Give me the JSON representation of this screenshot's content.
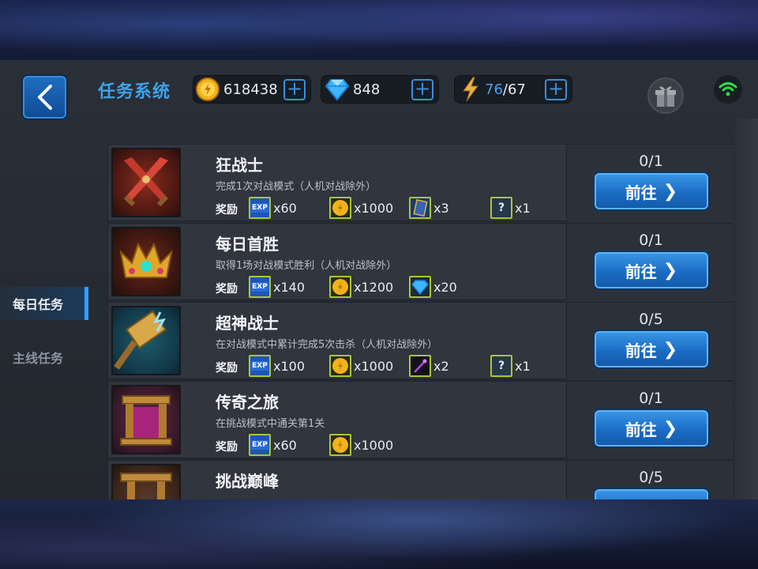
{
  "header": {
    "title": "任务系统",
    "back_icon": "chevron-left-icon",
    "gold": {
      "icon": "gold-coin-icon",
      "value": "618438"
    },
    "diamond": {
      "icon": "diamond-icon",
      "value": "848"
    },
    "energy": {
      "icon": "lightning-icon",
      "current": "76",
      "max": "/67"
    },
    "plus_label": "+",
    "gift_icon": "gift-icon",
    "wifi_icon": "wifi-icon"
  },
  "sidebar": {
    "tabs": [
      {
        "label": "每日任务",
        "active": true
      },
      {
        "label": "主线任务",
        "active": false
      }
    ]
  },
  "reward_label": "奖励",
  "goto_label": "前往",
  "quests": [
    {
      "name": "狂战士",
      "desc": "完成1次对战模式（人机对战除外）",
      "progress": "0/1",
      "icon": "crossed-swords-icon",
      "rewards": [
        {
          "icon": "exp-icon",
          "count": "x60"
        },
        {
          "icon": "gold-coin-icon",
          "count": "x1000"
        },
        {
          "icon": "card-icon",
          "count": "x3"
        },
        {
          "icon": "mystery-box-icon",
          "count": "x1"
        }
      ]
    },
    {
      "name": "每日首胜",
      "desc": "取得1场对战模式胜利（人机对战除外）",
      "progress": "0/1",
      "icon": "crown-icon",
      "rewards": [
        {
          "icon": "exp-icon",
          "count": "x140"
        },
        {
          "icon": "gold-coin-icon",
          "count": "x1200"
        },
        {
          "icon": "diamond-icon",
          "count": "x20"
        }
      ]
    },
    {
      "name": "超神战士",
      "desc": "在对战模式中累计完成5次击杀（人机对战除外）",
      "progress": "0/5",
      "icon": "thunder-hammer-icon",
      "rewards": [
        {
          "icon": "exp-icon",
          "count": "x100"
        },
        {
          "icon": "gold-coin-icon",
          "count": "x1000"
        },
        {
          "icon": "staff-icon",
          "count": "x2"
        },
        {
          "icon": "mystery-box-icon",
          "count": "x1"
        }
      ]
    },
    {
      "name": "传奇之旅",
      "desc": "在挑战模式中通关第1关",
      "progress": "0/1",
      "icon": "portal-gate-icon",
      "rewards": [
        {
          "icon": "exp-icon",
          "count": "x60"
        },
        {
          "icon": "gold-coin-icon",
          "count": "x1000"
        }
      ]
    },
    {
      "name": "挑战巅峰",
      "desc": "",
      "progress": "0/5",
      "icon": "pillar-gate-icon",
      "rewards": []
    }
  ]
}
